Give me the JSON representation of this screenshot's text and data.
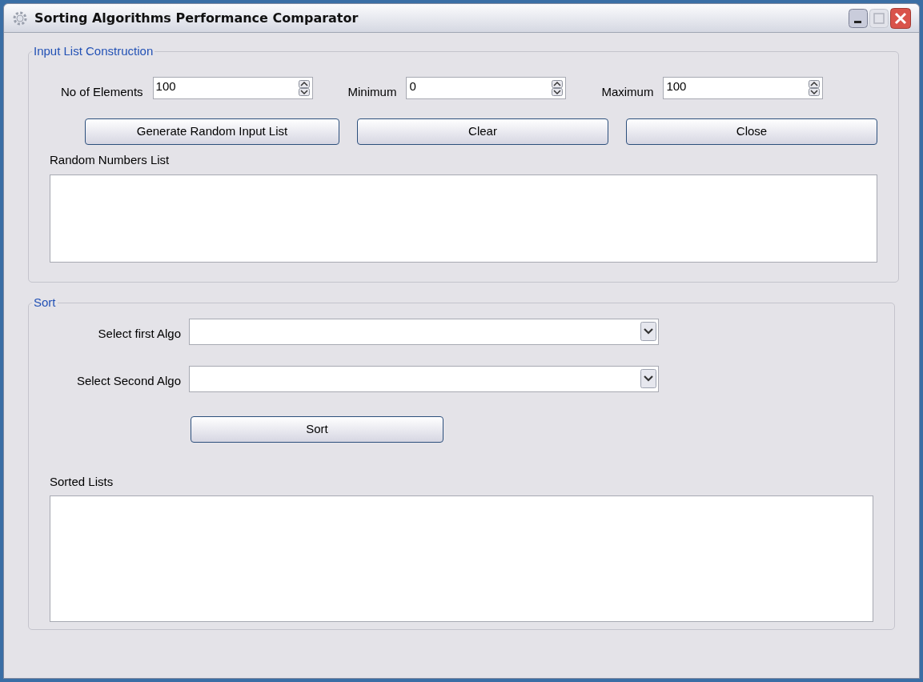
{
  "window": {
    "title": "Sorting Algorithms Performance Comparator"
  },
  "input_group": {
    "legend": "Input List Construction",
    "fields": [
      {
        "label": "No of Elements",
        "value": "100"
      },
      {
        "label": "Minimum",
        "value": "0"
      },
      {
        "label": "Maximum",
        "value": "100"
      }
    ],
    "buttons": [
      "Generate Random Input List",
      "Clear",
      "Close"
    ],
    "list_label": "Random Numbers List"
  },
  "sort_group": {
    "legend": "Sort",
    "selects": [
      {
        "label": "Select first Algo"
      },
      {
        "label": "Select Second Algo"
      }
    ],
    "button": "Sort",
    "list_label": "Sorted Lists"
  }
}
